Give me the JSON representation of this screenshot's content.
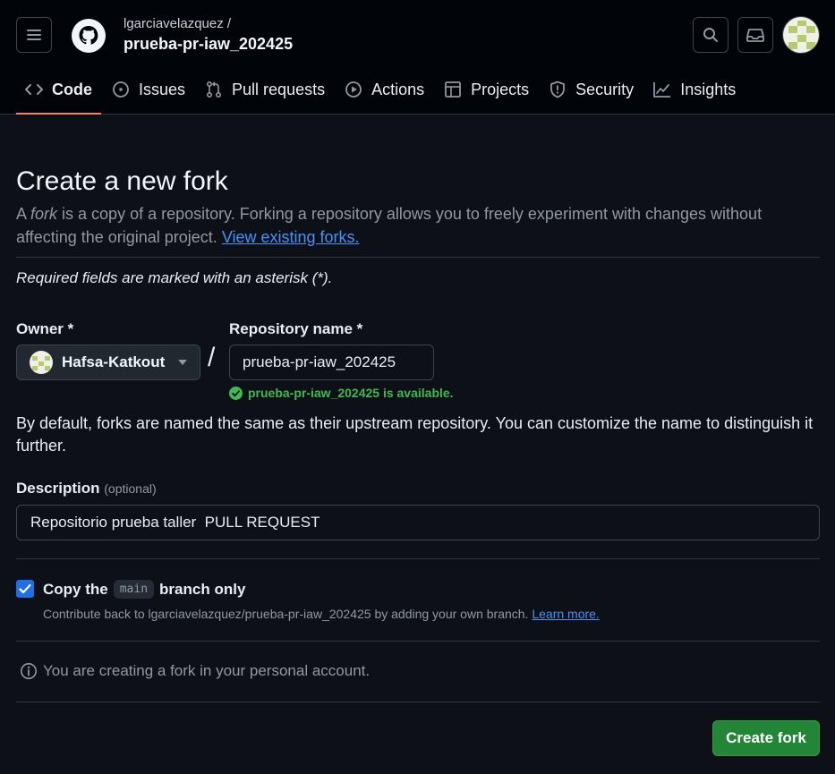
{
  "header": {
    "owner": "lgarciavelazquez /",
    "repo": "prueba-pr-iaw_202425",
    "nav": [
      {
        "label": "Code",
        "icon": "code-icon"
      },
      {
        "label": "Issues",
        "icon": "issue-icon"
      },
      {
        "label": "Pull requests",
        "icon": "pull-request-icon"
      },
      {
        "label": "Actions",
        "icon": "play-icon"
      },
      {
        "label": "Projects",
        "icon": "table-icon"
      },
      {
        "label": "Security",
        "icon": "shield-icon"
      },
      {
        "label": "Insights",
        "icon": "graph-icon"
      }
    ]
  },
  "page": {
    "title": "Create a new fork",
    "intro_a": "A ",
    "intro_fork": "fork",
    "intro_b": " is a copy of a repository. Forking a repository allows you to freely experiment with changes without affecting the original project. ",
    "intro_link": "View existing forks.",
    "required_note": "Required fields are marked with an asterisk (*).",
    "owner_label": "Owner *",
    "owner_value": "Hafsa-Katkout",
    "repo_label": "Repository name *",
    "repo_value": "prueba-pr-iaw_202425",
    "availability": "prueba-pr-iaw_202425 is available.",
    "default_note": "By default, forks are named the same as their upstream repository. You can customize the name to distinguish it further.",
    "description_label": "Description",
    "description_optional": "(optional)",
    "description_value": "Repositorio prueba taller  PULL REQUEST",
    "copy_label_a": "Copy the",
    "copy_branch": "main",
    "copy_label_b": "branch only",
    "copy_sub": "Contribute back to lgarciavelazquez/prueba-pr-iaw_202425 by adding your own branch.",
    "copy_learn": "Learn more.",
    "personal_note": "You are creating a fork in your personal account.",
    "create_button": "Create fork"
  },
  "colors": {
    "background": "#0d1117",
    "header_bg": "#010409",
    "accent_link": "#4493f8",
    "success": "#3fb950",
    "primary_button": "#238636",
    "nav_underline": "#f78166"
  }
}
